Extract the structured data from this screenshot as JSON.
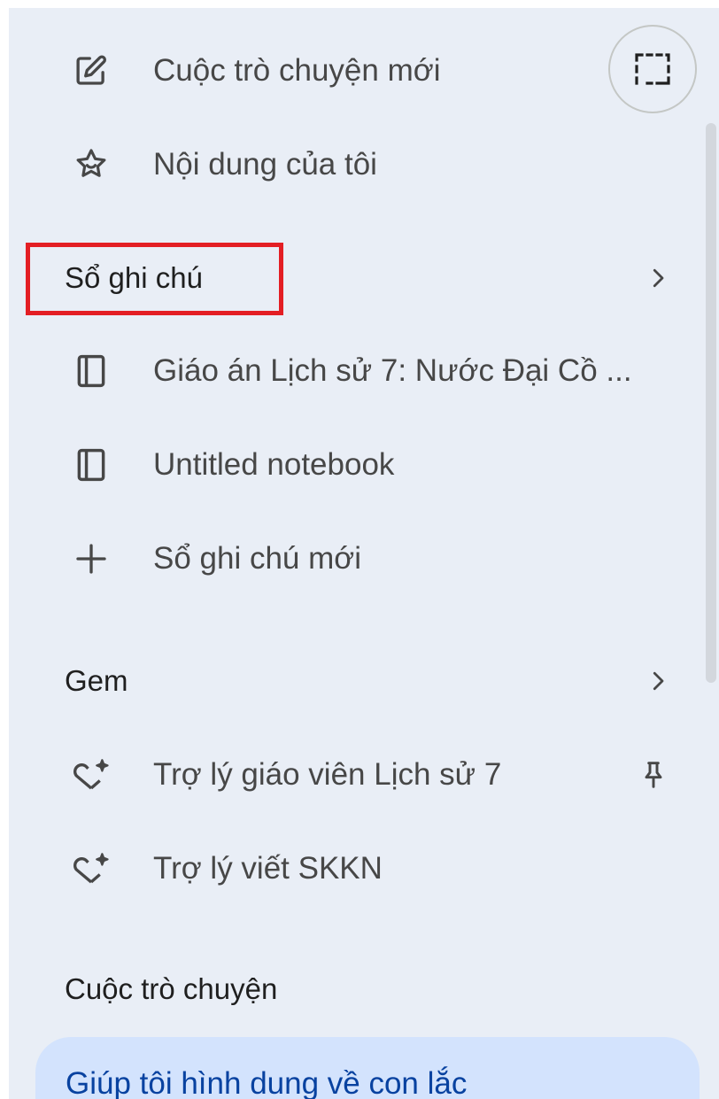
{
  "menu": {
    "new_chat": "Cuộc trò chuyện mới",
    "my_content": "Nội dung của tôi"
  },
  "notebooks": {
    "heading": "Sổ ghi chú",
    "items": [
      {
        "label": "Giáo án Lịch sử 7: Nước Đại Cồ ...",
        "icon": "notebook-icon"
      },
      {
        "label": "Untitled notebook",
        "icon": "notebook-icon"
      }
    ],
    "new_label": "Sổ ghi chú mới"
  },
  "gems": {
    "heading": "Gem",
    "items": [
      {
        "label": "Trợ lý giáo viên Lịch sử 7",
        "icon": "gem-icon",
        "pinned": true
      },
      {
        "label": "Trợ lý viết SKKN",
        "icon": "gem-icon",
        "pinned": false
      }
    ]
  },
  "chats": {
    "heading": "Cuộc trò chuyện",
    "items": [
      {
        "label": "Giúp tôi hình dung về con lắc",
        "active": true
      }
    ]
  },
  "colors": {
    "panel_bg": "#e9eef6",
    "highlight_box": "#e31e24",
    "active_chat_bg": "#d3e3fd",
    "active_chat_text": "#0842a0"
  }
}
